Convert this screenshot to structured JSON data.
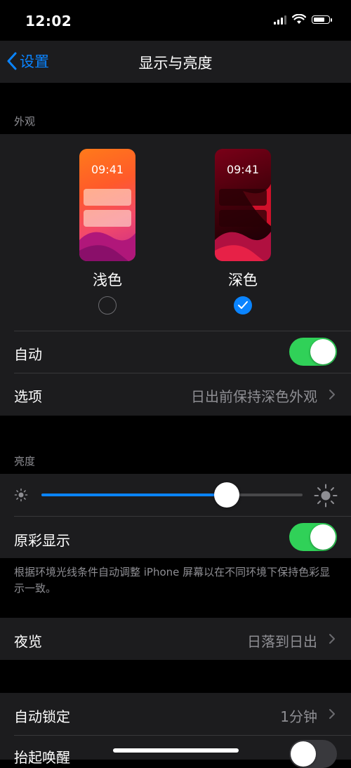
{
  "status_bar": {
    "time": "12:02"
  },
  "nav": {
    "back_label": "设置",
    "title": "显示与亮度"
  },
  "appearance": {
    "header": "外观",
    "light": {
      "preview_time": "09:41",
      "label": "浅色",
      "selected": false
    },
    "dark": {
      "preview_time": "09:41",
      "label": "深色",
      "selected": true
    },
    "auto": {
      "label": "自动",
      "on": true
    },
    "options": {
      "label": "选项",
      "value": "日出前保持深色外观"
    }
  },
  "brightness": {
    "header": "亮度",
    "level": 0.71,
    "true_tone": {
      "label": "原彩显示",
      "on": true
    },
    "footnote": "根据环境光线条件自动调整 iPhone 屏幕以在不同环境下保持色彩显示一致。"
  },
  "night_shift": {
    "label": "夜览",
    "value": "日落到日出"
  },
  "auto_lock": {
    "label": "自动锁定",
    "value": "1分钟"
  },
  "raise_to_wake": {
    "label": "抬起唤醒",
    "on": false
  },
  "colors": {
    "accent": "#0a84ff",
    "toggle_on": "#30d158",
    "background": "#000000",
    "cell": "#1c1c1e"
  }
}
